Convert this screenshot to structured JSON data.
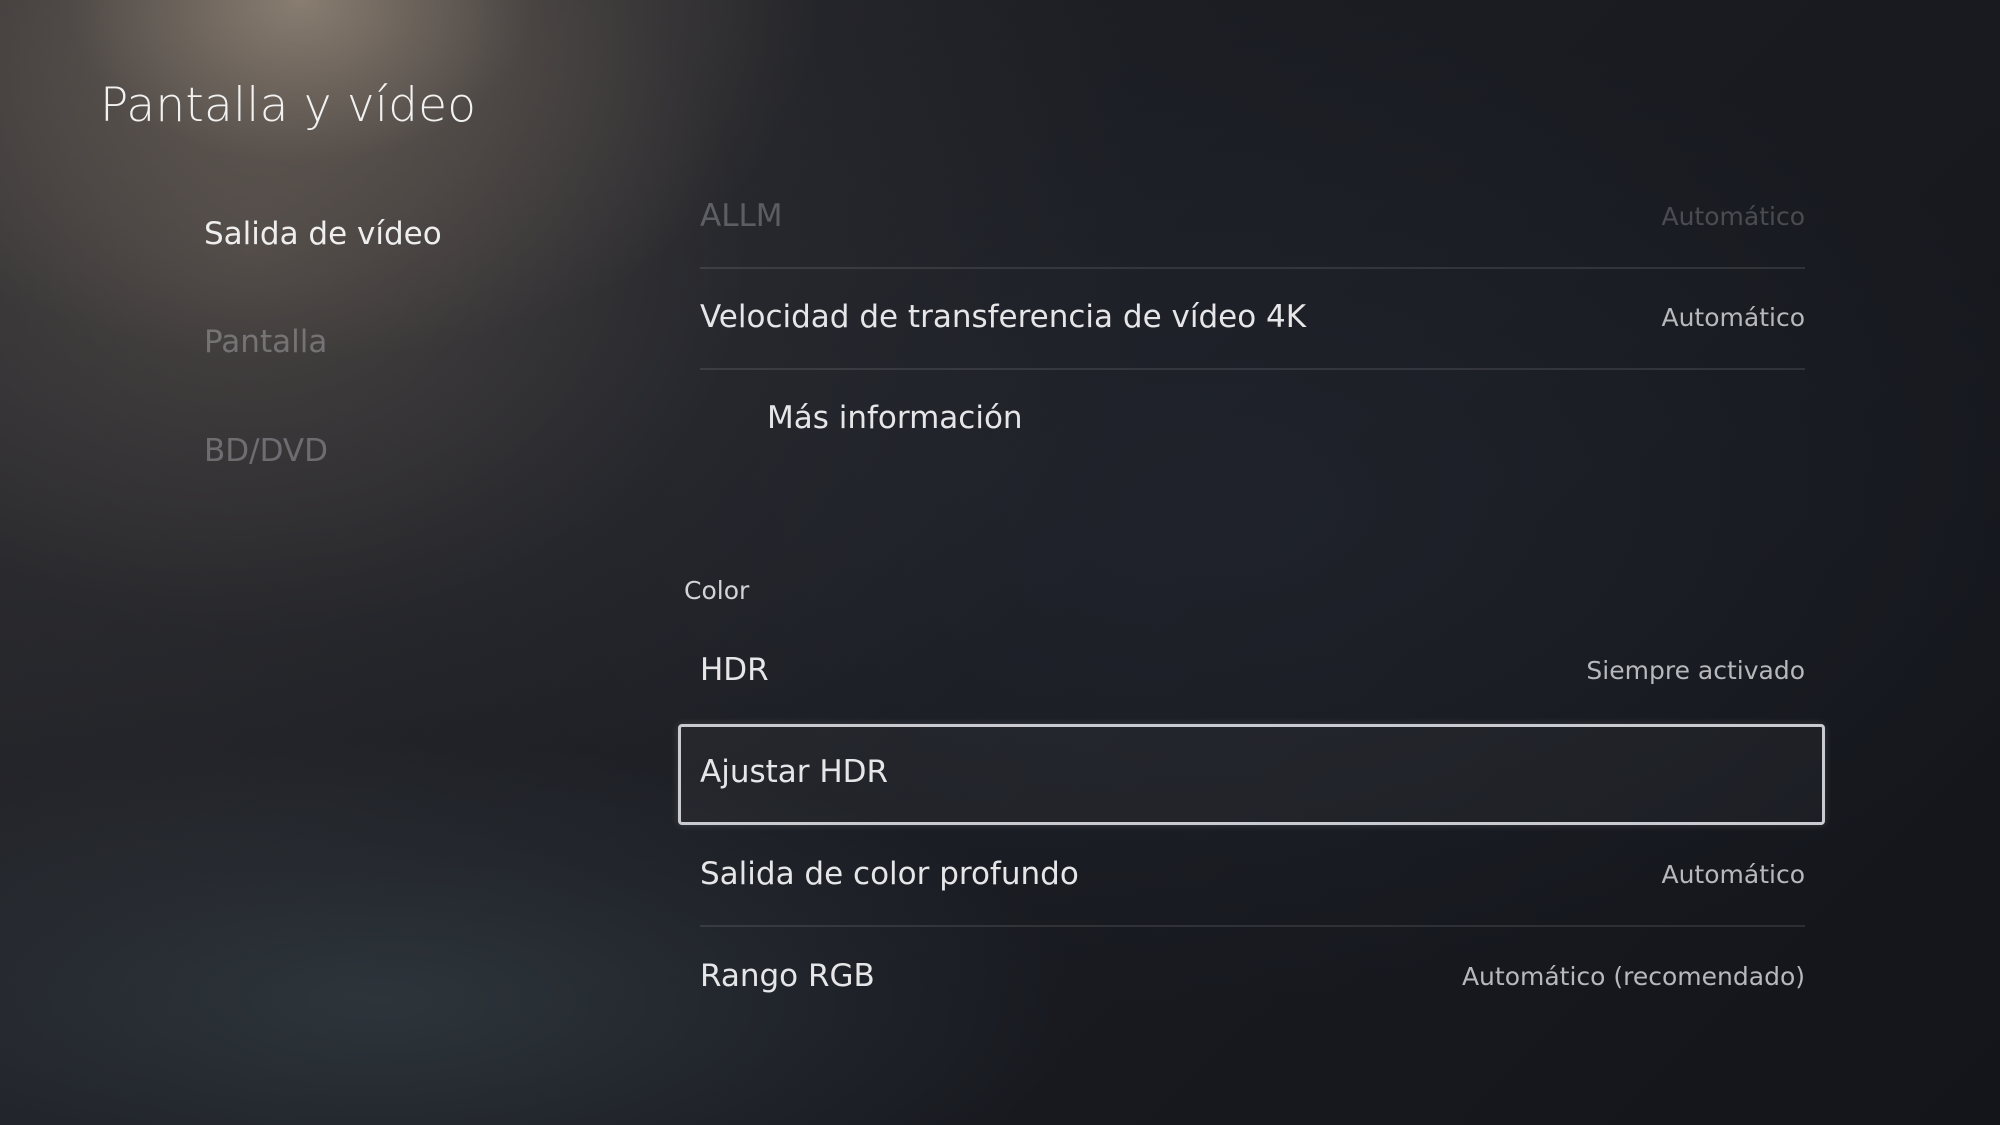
{
  "page": {
    "title": "Pantalla y vídeo"
  },
  "sidebar": {
    "items": [
      {
        "label": "Salida de vídeo",
        "state": "active"
      },
      {
        "label": "Pantalla",
        "state": "inactive"
      },
      {
        "label": "BD/DVD",
        "state": "inactive"
      }
    ]
  },
  "video_section": {
    "rows": [
      {
        "label": "ALLM",
        "value": "Automático"
      },
      {
        "label": "Velocidad de transferencia de vídeo 4K",
        "value": "Automático"
      },
      {
        "label": "Más información",
        "value": ""
      }
    ]
  },
  "color_section": {
    "header": "Color",
    "rows": [
      {
        "label": "HDR",
        "value": "Siempre activado"
      },
      {
        "label": "Ajustar HDR",
        "value": "",
        "focused": true
      },
      {
        "label": "Salida de color profundo",
        "value": "Automático"
      },
      {
        "label": "Rango RGB",
        "value": "Automático (recomendado)"
      }
    ]
  }
}
